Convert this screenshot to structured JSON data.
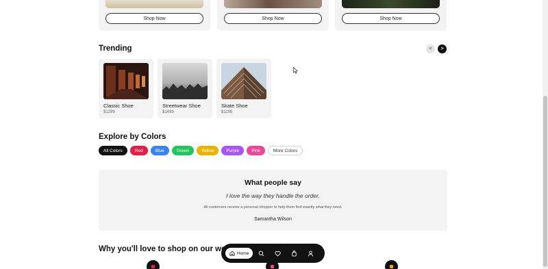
{
  "promos": [
    {
      "button_label": "Shop Now",
      "image_color": "#d8cab4"
    },
    {
      "button_label": "Shop Now",
      "image_color": "#7a6a60"
    },
    {
      "button_label": "Shop Now",
      "image_color": "#2c3324"
    }
  ],
  "trending": {
    "title": "Trending",
    "prev_label": "<",
    "next_label": ">",
    "products": [
      {
        "name": "Classic Shoe",
        "price": "$1299"
      },
      {
        "name": "Streetwear Shoe",
        "price": "$1499"
      },
      {
        "name": "Skate Shoe",
        "price": "$1199"
      }
    ]
  },
  "colors": {
    "title": "Explore by Colors",
    "chips": [
      {
        "label": "All Colors",
        "bg": "#111111",
        "fg": "#ffffff"
      },
      {
        "label": "Red",
        "bg": "#e11d48",
        "fg": "#ffffff"
      },
      {
        "label": "Blue",
        "bg": "#3b82f6",
        "fg": "#ffffff"
      },
      {
        "label": "Green",
        "bg": "#22c55e",
        "fg": "#ffffff"
      },
      {
        "label": "Yellow",
        "bg": "#eab308",
        "fg": "#ffffff"
      },
      {
        "label": "Purple",
        "bg": "#a855f7",
        "fg": "#ffffff"
      },
      {
        "label": "Pink",
        "bg": "#ec4899",
        "fg": "#ffffff"
      },
      {
        "label": "More Colors",
        "bg": "#ffffff",
        "fg": "#333333"
      }
    ]
  },
  "testimonial": {
    "title": "What people say",
    "quote": "I love the way they handle the order.",
    "body": "All customers receive a personal shopper to help them find exactly what they need.",
    "author": "Samantha Wilson"
  },
  "why": {
    "title": "Why you'll love to shop on our website"
  },
  "bottom_nav": {
    "home_label": "Home",
    "icons": [
      "search-icon",
      "heart-icon",
      "bag-icon",
      "user-icon"
    ]
  }
}
